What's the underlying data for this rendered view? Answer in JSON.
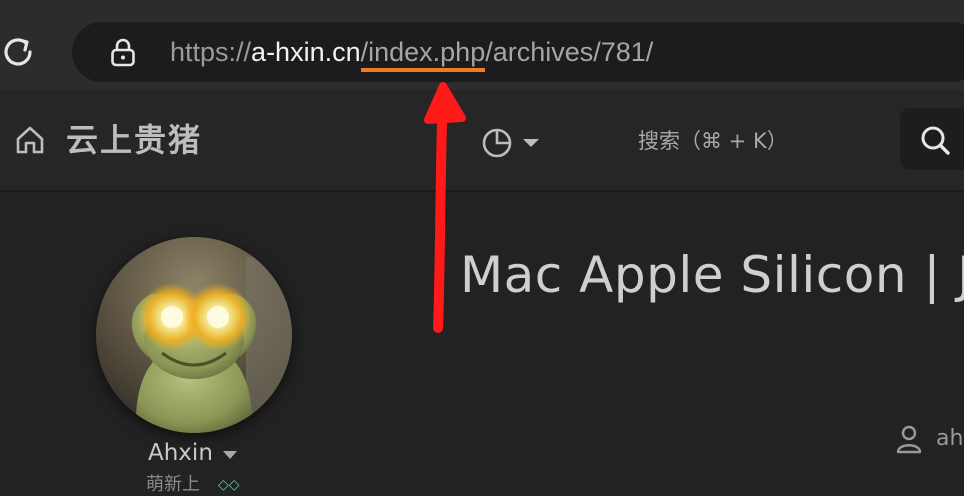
{
  "browser": {
    "url": {
      "scheme": "https://",
      "host": "a-hxin.cn",
      "highlighted": "/index.php",
      "rest": "/archives/781/"
    }
  },
  "site": {
    "title": "云上贵猪",
    "search_label": "搜索（⌘ + K）"
  },
  "post": {
    "title": "Mac Apple Silicon | Ja",
    "meta_author": "ah"
  },
  "author": {
    "name": "Ahxin",
    "subtitle": "萌新上",
    "badge": "◇◇"
  },
  "colors": {
    "highlight_underline": "#f27b1e",
    "annotation_arrow": "#ff1a1a"
  },
  "icons": [
    "reload-icon",
    "lock-icon",
    "home-icon",
    "theme-icon",
    "chevron-down-icon",
    "search-icon",
    "user-icon"
  ]
}
